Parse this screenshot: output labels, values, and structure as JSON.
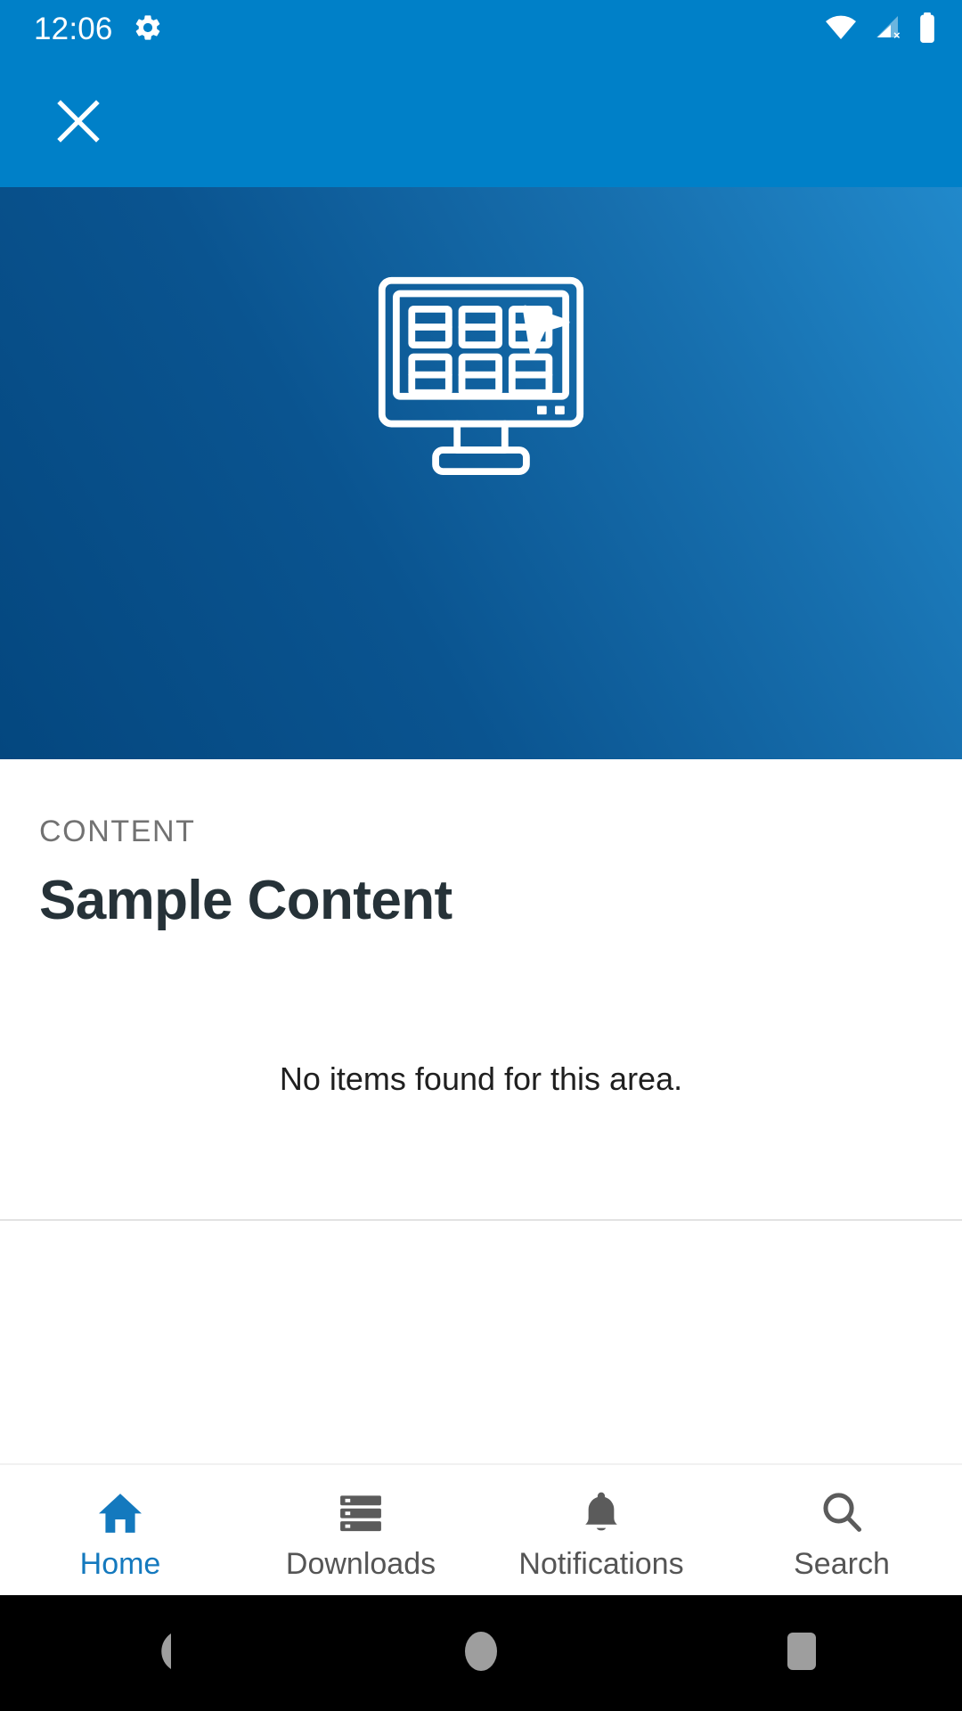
{
  "status_bar": {
    "time": "12:06",
    "icons": [
      "gear-icon",
      "wifi-icon",
      "cellular-no-sim-icon",
      "battery-icon"
    ],
    "background_color": "#0080C8",
    "foreground_color": "#FFFFFF"
  },
  "app_bar": {
    "close_label": "Close",
    "background_color": "#0080C8"
  },
  "hero": {
    "illustration": "desktop-monitor-grid-cursor-icon",
    "gradient_from": "#04477F",
    "gradient_to": "#2189CB"
  },
  "content": {
    "eyebrow": "CONTENT",
    "title": "Sample Content",
    "empty_message": "No items found for this area.",
    "eyebrow_color": "#727272",
    "title_color": "#263238"
  },
  "bottom_nav": {
    "active_color": "#1479BE",
    "inactive_color": "#555555",
    "items": [
      {
        "label": "Home",
        "icon": "home-icon",
        "active": true
      },
      {
        "label": "Downloads",
        "icon": "storage-list-icon",
        "active": false
      },
      {
        "label": "Notifications",
        "icon": "bell-icon",
        "active": false
      },
      {
        "label": "Search",
        "icon": "search-icon",
        "active": false
      }
    ]
  },
  "system_nav": {
    "buttons": [
      {
        "name": "back-button",
        "icon": "triangle-left-icon"
      },
      {
        "name": "home-button",
        "icon": "circle-icon"
      },
      {
        "name": "recents-button",
        "icon": "square-icon"
      }
    ],
    "background_color": "#000000",
    "icon_color": "#9E9E9E"
  }
}
